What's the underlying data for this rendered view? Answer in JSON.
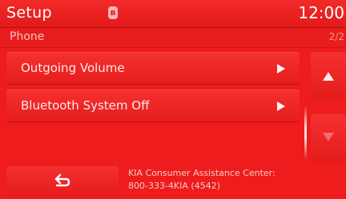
{
  "header": {
    "title": "Setup",
    "clock": "12:00",
    "bluetooth_glyph": "ʙ"
  },
  "subheader": {
    "title": "Phone",
    "page": "2/2"
  },
  "list": {
    "items": [
      {
        "label": "Outgoing Volume",
        "icon": "play-arrow-icon"
      },
      {
        "label": "Bluetooth System Off",
        "icon": "play-arrow-icon"
      }
    ]
  },
  "scroll": {
    "up_icon": "chevron-up-icon",
    "down_icon": "chevron-down-icon",
    "down_enabled": false
  },
  "footer": {
    "back_icon": "back-arrow-icon",
    "info_line1": "KIA Consumer Assistance Center:",
    "info_line2": "800-333-4KIA (4542)"
  },
  "colors": {
    "background": "#ee1c1c",
    "text": "#ffffff",
    "muted_text": "#f7c2c2"
  }
}
